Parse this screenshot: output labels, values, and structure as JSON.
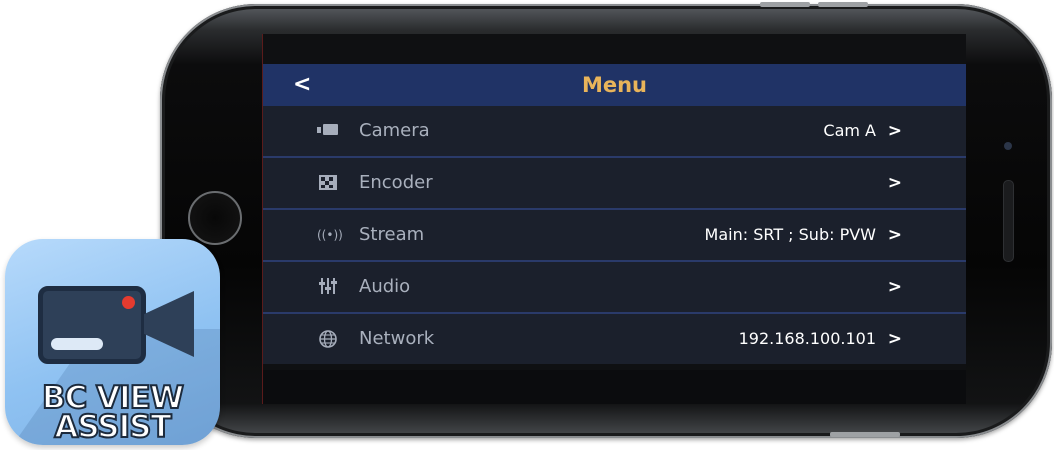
{
  "header": {
    "back_label": "<",
    "title": "Menu"
  },
  "menu_items": [
    {
      "icon": "camera-icon",
      "glyph": "▮◼",
      "label": "Camera",
      "value": "Cam A",
      "chevron": ">"
    },
    {
      "icon": "encoder-icon",
      "glyph": "▚",
      "label": "Encoder",
      "value": "",
      "chevron": ">"
    },
    {
      "icon": "stream-icon",
      "glyph": "((•))",
      "label": "Stream",
      "value": "Main: SRT ; Sub: PVW",
      "chevron": ">"
    },
    {
      "icon": "audio-mixer-icon",
      "glyph": "⫶⫶⫶",
      "label": "Audio",
      "value": "",
      "chevron": ">"
    },
    {
      "icon": "globe-icon",
      "glyph": "◍",
      "label": "Network",
      "value": "192.168.100.101",
      "chevron": ">"
    }
  ],
  "app_icon": {
    "name_line1": "BC VIEW",
    "name_line2": "ASSIST"
  },
  "colors": {
    "header_bg": "#203366",
    "title": "#e9b45a",
    "row_bg": "#1b202c",
    "divider": "#2a3a6a",
    "record_dot": "#e53b2f"
  }
}
